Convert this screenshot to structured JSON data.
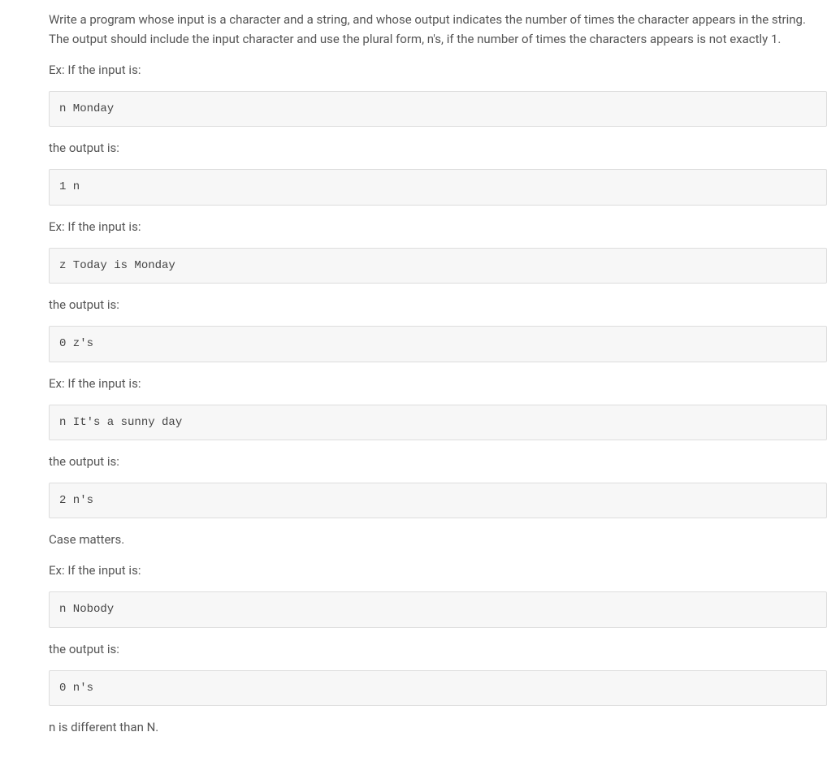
{
  "content": {
    "intro": "Write a program whose input is a character and a string, and whose output indicates the number of times the character appears in the string. The output should include the input character and use the plural form, n's, if the number of times the characters appears is not exactly 1.",
    "ex1_label": "Ex: If the input is:",
    "ex1_input": "n Monday",
    "ex1_output_label": "the output is:",
    "ex1_output": "1 n",
    "ex2_label": "Ex: If the input is:",
    "ex2_input": "z Today is Monday",
    "ex2_output_label": "the output is:",
    "ex2_output": "0 z's",
    "ex3_label": "Ex: If the input is:",
    "ex3_input": "n It's a sunny day",
    "ex3_output_label": "the output is:",
    "ex3_output": "2 n's",
    "case_note": "Case matters.",
    "ex4_label": "Ex: If the input is:",
    "ex4_input": "n Nobody",
    "ex4_output_label": "the output is:",
    "ex4_output": "0 n's",
    "final_note": "n is different than N."
  }
}
